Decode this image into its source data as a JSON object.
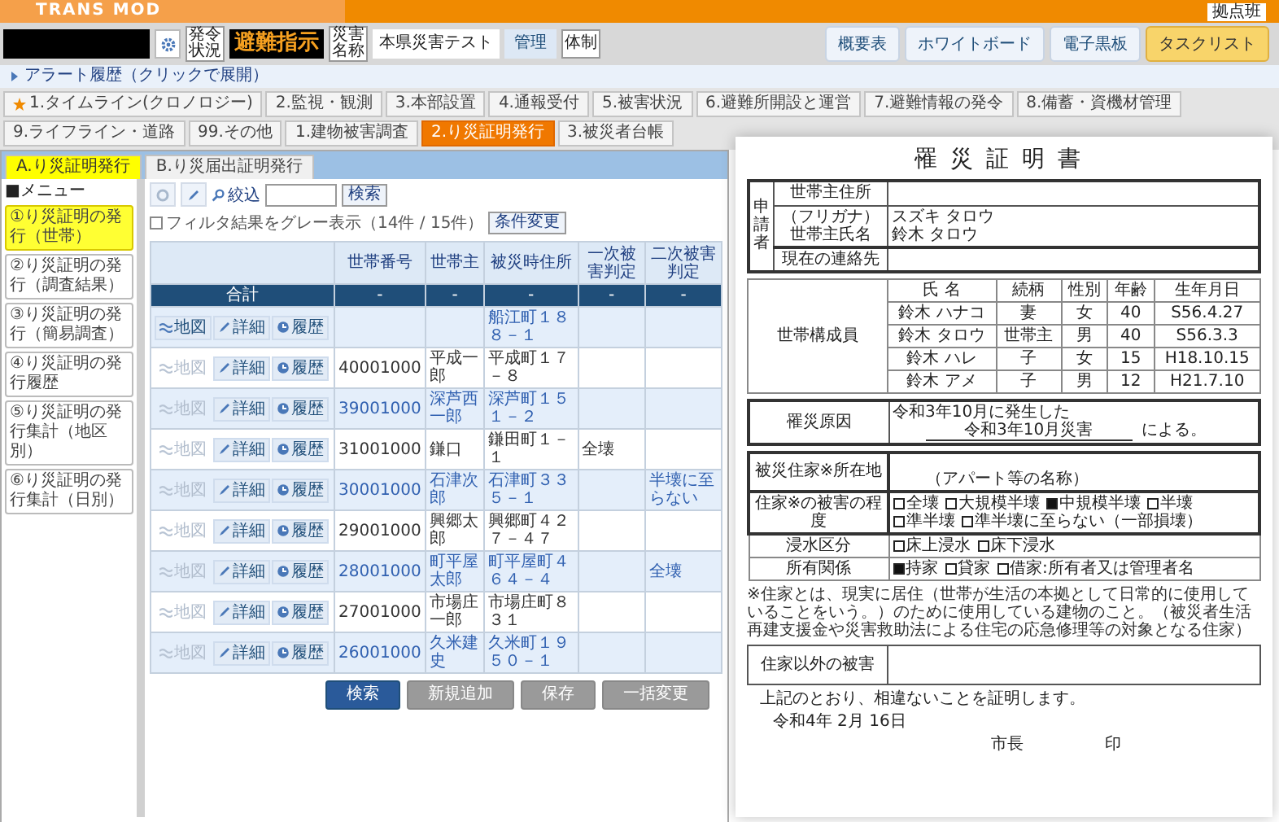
{
  "header": {
    "logo": "TRANS MOD",
    "user": "拠点班",
    "order_label": "発令状況",
    "order": "避難指示",
    "disaster_label": "災害名称",
    "disaster": "本県災害テスト",
    "mode": "管理",
    "system_label": "体制",
    "buttons": [
      {
        "label": "概要表",
        "highlighted": false
      },
      {
        "label": "ホワイトボード",
        "highlighted": false
      },
      {
        "label": "電子黒板",
        "highlighted": false
      },
      {
        "label": "タスクリスト",
        "highlighted": true
      }
    ],
    "alert": "アラート履歴（クリックで展開）"
  },
  "tabs": [
    {
      "label": "1.タイムライン(クロノロジー)",
      "selected": false,
      "starred": true
    },
    {
      "label": "2.監視・観測",
      "selected": false,
      "starred": false
    },
    {
      "label": "3.本部設置",
      "selected": false,
      "starred": false
    },
    {
      "label": "4.通報受付",
      "selected": false,
      "starred": false
    },
    {
      "label": "5.被害状況",
      "selected": false,
      "starred": false
    },
    {
      "label": "6.避難所開設と運営",
      "selected": false,
      "starred": false
    },
    {
      "label": "7.避難情報の発令",
      "selected": false,
      "starred": false
    },
    {
      "label": "8.備蓄・資機材管理",
      "selected": false,
      "starred": false
    },
    {
      "label": "9.ライフライン・道路",
      "selected": false,
      "starred": false
    },
    {
      "label": "99.その他",
      "selected": false,
      "starred": false
    },
    {
      "label": "1.建物被害調査",
      "selected": false,
      "starred": false
    },
    {
      "label": "2.り災証明発行",
      "selected": true,
      "starred": false
    },
    {
      "label": "3.被災者台帳",
      "selected": false,
      "starred": false
    }
  ],
  "subtabs": [
    {
      "label": "A.り災証明発行",
      "selected": true
    },
    {
      "label": "B.り災届出証明発行",
      "selected": false
    }
  ],
  "sidebar": {
    "heading": "■メニュー",
    "items": [
      {
        "label": "①り災証明の発行（世帯）",
        "selected": true
      },
      {
        "label": "②り災証明の発行（調査結果）",
        "selected": false
      },
      {
        "label": "③り災証明の発行（簡易調査）",
        "selected": false
      },
      {
        "label": "④り災証明の発行履歴",
        "selected": false
      },
      {
        "label": "⑤り災証明の発行集計（地区別）",
        "selected": false
      },
      {
        "label": "⑥り災証明の発行集計（日別）",
        "selected": false
      }
    ]
  },
  "toolbar": {
    "filter_label": "絞込",
    "search_button": "検索",
    "gray_filter": {
      "label": "フィルタ結果をグレー表示（14件 / 15件）",
      "checked": false
    },
    "condition_button": "条件変更"
  },
  "table": {
    "columns": [
      "世帯番号",
      "世帯主",
      "被災時住所",
      "一次被害判定",
      "二次被害判定"
    ],
    "total": {
      "label": "合計",
      "values": [
        "-",
        "-",
        "-",
        "-",
        "-"
      ]
    },
    "rows": [
      {
        "actions": [
          {
            "kind": "map",
            "label": "地図",
            "disabled": false
          },
          {
            "kind": "edit",
            "label": "詳細",
            "disabled": false
          },
          {
            "kind": "history",
            "label": "履歴",
            "disabled": false
          }
        ],
        "cells": [
          null,
          null,
          "船江町１８８－１",
          null,
          null
        ]
      },
      {
        "actions": [
          {
            "kind": "map",
            "label": "地図",
            "disabled": true
          },
          {
            "kind": "edit",
            "label": "詳細",
            "disabled": false
          },
          {
            "kind": "history",
            "label": "履歴",
            "disabled": false
          }
        ],
        "cells": [
          "40001000",
          "平成一郎",
          "平成町１７－８",
          null,
          null
        ]
      },
      {
        "actions": [
          {
            "kind": "map",
            "label": "地図",
            "disabled": true
          },
          {
            "kind": "edit",
            "label": "詳細",
            "disabled": false
          },
          {
            "kind": "history",
            "label": "履歴",
            "disabled": false
          }
        ],
        "cells": [
          "39001000",
          "深芦西一郎",
          "深芦町１５１－２",
          null,
          null
        ]
      },
      {
        "actions": [
          {
            "kind": "map",
            "label": "地図",
            "disabled": true
          },
          {
            "kind": "edit",
            "label": "詳細",
            "disabled": false
          },
          {
            "kind": "history",
            "label": "履歴",
            "disabled": false
          }
        ],
        "cells": [
          "31001000",
          "鎌口",
          "鎌田町１－１",
          "全壊",
          null
        ]
      },
      {
        "actions": [
          {
            "kind": "map",
            "label": "地図",
            "disabled": true
          },
          {
            "kind": "edit",
            "label": "詳細",
            "disabled": false
          },
          {
            "kind": "history",
            "label": "履歴",
            "disabled": false
          }
        ],
        "cells": [
          "30001000",
          "石津次郎",
          "石津町３３５－１",
          null,
          "半壊に至らない"
        ]
      },
      {
        "actions": [
          {
            "kind": "map",
            "label": "地図",
            "disabled": true
          },
          {
            "kind": "edit",
            "label": "詳細",
            "disabled": false
          },
          {
            "kind": "history",
            "label": "履歴",
            "disabled": false
          }
        ],
        "cells": [
          "29001000",
          "興郷太郎",
          "興郷町４２７－４７",
          null,
          null
        ]
      },
      {
        "actions": [
          {
            "kind": "map",
            "label": "地図",
            "disabled": true
          },
          {
            "kind": "edit",
            "label": "詳細",
            "disabled": false
          },
          {
            "kind": "history",
            "label": "履歴",
            "disabled": false
          }
        ],
        "cells": [
          "28001000",
          "町平屋太郎",
          "町平屋町４６４－４",
          null,
          "全壊"
        ]
      },
      {
        "actions": [
          {
            "kind": "map",
            "label": "地図",
            "disabled": true
          },
          {
            "kind": "edit",
            "label": "詳細",
            "disabled": false
          },
          {
            "kind": "history",
            "label": "履歴",
            "disabled": false
          }
        ],
        "cells": [
          "27001000",
          "市場庄一郎",
          "市場庄町８３１",
          null,
          null
        ]
      },
      {
        "actions": [
          {
            "kind": "map",
            "label": "地図",
            "disabled": true
          },
          {
            "kind": "edit",
            "label": "詳細",
            "disabled": false
          },
          {
            "kind": "history",
            "label": "履歴",
            "disabled": false
          }
        ],
        "cells": [
          "26001000",
          "久米建史",
          "久米町１９５０－１",
          null,
          null
        ]
      }
    ]
  },
  "buttons": [
    {
      "label": "検索",
      "kind": "primary"
    },
    {
      "label": "新規追加",
      "kind": "secondary"
    },
    {
      "label": "保存",
      "kind": "secondary"
    },
    {
      "label": "一括変更",
      "kind": "secondary"
    }
  ],
  "document": {
    "title": "罹災証明書",
    "applicant": {
      "label": "申請者",
      "address_label": "世帯主住所",
      "kana_label": "（フリガナ）",
      "name_label": "世帯主氏名",
      "kana": "スズキ タロウ",
      "name": "鈴木 タロウ",
      "contact_label": "現在の連絡先"
    },
    "household": {
      "label": "世帯構成員",
      "columns": [
        "氏 名",
        "続柄",
        "性別",
        "年齢",
        "生年月日"
      ],
      "rows": [
        [
          "鈴木 ハナコ",
          "妻",
          "女",
          "40",
          "S56.4.27"
        ],
        [
          "鈴木 タロウ",
          "世帯主",
          "男",
          "40",
          "S56.3.3"
        ],
        [
          "鈴木 ハレ",
          "子",
          "女",
          "15",
          "H18.10.15"
        ],
        [
          "鈴木 アメ",
          "子",
          "男",
          "12",
          "H21.7.10"
        ]
      ]
    },
    "cause": {
      "label": "罹災原因",
      "line": "令和3年10月に発生した",
      "disaster": "令和3年10月災害",
      "suffix": "による。"
    },
    "dwelling": [
      {
        "kind": "address",
        "label": "被災住家※所在地",
        "note": "（アパート等の名称）"
      },
      {
        "kind": "options",
        "label": "住家※の被害の程度",
        "options": [
          {
            "label": "全壊",
            "checked": false
          },
          {
            "label": "大規模半壊",
            "checked": false
          },
          {
            "label": "中規模半壊",
            "checked": true
          },
          {
            "label": "半壊",
            "checked": false
          },
          {
            "label": "準半壊",
            "checked": false
          },
          {
            "label": "準半壊に至らない（一部損壊）",
            "checked": false
          }
        ]
      },
      {
        "kind": "options",
        "label": "浸水区分",
        "options": [
          {
            "label": "床上浸水",
            "checked": false
          },
          {
            "label": "床下浸水",
            "checked": false
          }
        ]
      },
      {
        "kind": "options",
        "label": "所有関係",
        "options": [
          {
            "label": "持家",
            "checked": true
          },
          {
            "label": "貸家",
            "checked": false
          },
          {
            "label": "借家:所有者又は管理者名",
            "checked": false
          }
        ]
      }
    ],
    "footnote": "※住家とは、現実に居住（世帯が生活の本拠として日常的に使用していることをいう。）のために使用している建物のこと。（被災者生活再建支援金や災害救助法による住宅の応急修理等の対象となる住家）",
    "other_label": "住家以外の被害",
    "statement": "上記のとおり、相違ないことを証明します。",
    "date": "令和4年 2月 16日",
    "signer": "市長",
    "seal": "印"
  }
}
